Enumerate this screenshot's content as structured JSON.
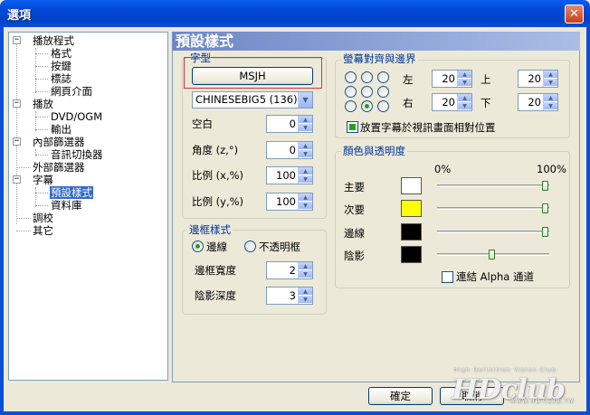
{
  "window": {
    "title": "選項",
    "close_glyph": "✕"
  },
  "tree": {
    "items": [
      {
        "label": "播放程式"
      },
      {
        "label": "格式"
      },
      {
        "label": "按鍵"
      },
      {
        "label": "標誌"
      },
      {
        "label": "網頁介面"
      },
      {
        "label": "播放"
      },
      {
        "label": "DVD/OGM"
      },
      {
        "label": "輸出"
      },
      {
        "label": "內部篩選器"
      },
      {
        "label": "音訊切換器"
      },
      {
        "label": "外部篩選器"
      },
      {
        "label": "字幕"
      },
      {
        "label": "預設樣式"
      },
      {
        "label": "資料庫"
      },
      {
        "label": "調校"
      },
      {
        "label": "其它"
      }
    ],
    "expander_minus": "−"
  },
  "page_title": "預設樣式",
  "font_group": {
    "title": "字型",
    "font_button": "MSJH",
    "charset": "CHINESEBIG5 (136)",
    "spacing_label": "空白",
    "spacing_value": "0",
    "angle_label": "角度 (z,°)",
    "angle_value": "0",
    "scale_x_label": "比例 (x,%)",
    "scale_x_value": "100",
    "scale_y_label": "比例 (y,%)",
    "scale_y_value": "100"
  },
  "border_group": {
    "title": "邊框樣式",
    "outline_label": "邊線",
    "opaque_label": "不透明框",
    "outline_selected": true,
    "border_width_label": "邊框寬度",
    "border_width_value": "2",
    "shadow_depth_label": "陰影深度",
    "shadow_depth_value": "3"
  },
  "margin_group": {
    "title": "螢幕對齊與邊界",
    "left_label": "左",
    "left_value": "20",
    "top_label": "上",
    "top_value": "20",
    "right_label": "右",
    "right_value": "20",
    "bottom_label": "下",
    "bottom_value": "20",
    "selected_alignment": 7,
    "relative_checkbox_label": "放置字幕於視訊畫面相對位置",
    "relative_checked": true
  },
  "color_group": {
    "title": "顏色與透明度",
    "min_label": "0%",
    "max_label": "100%",
    "rows": [
      {
        "label": "主要",
        "color": "#ffffff",
        "opacity_fraction": 1.0
      },
      {
        "label": "次要",
        "color": "#ffff00",
        "opacity_fraction": 1.0
      },
      {
        "label": "邊線",
        "color": "#000000",
        "opacity_fraction": 1.0
      },
      {
        "label": "陰影",
        "color": "#000000",
        "opacity_fraction": 0.5
      }
    ],
    "link_alpha_label": "連結 Alpha 通道",
    "link_alpha_checked": false
  },
  "buttons": {
    "ok": "確定",
    "cancel": "取消"
  },
  "watermark": {
    "tagline": "High Definition Vision Club",
    "logo": "HDclub",
    "sub": "WWW.HD.CLUB.TW"
  },
  "icons": {
    "combo_arrow": "▼",
    "spin_up": "▲",
    "spin_down": "▼"
  }
}
